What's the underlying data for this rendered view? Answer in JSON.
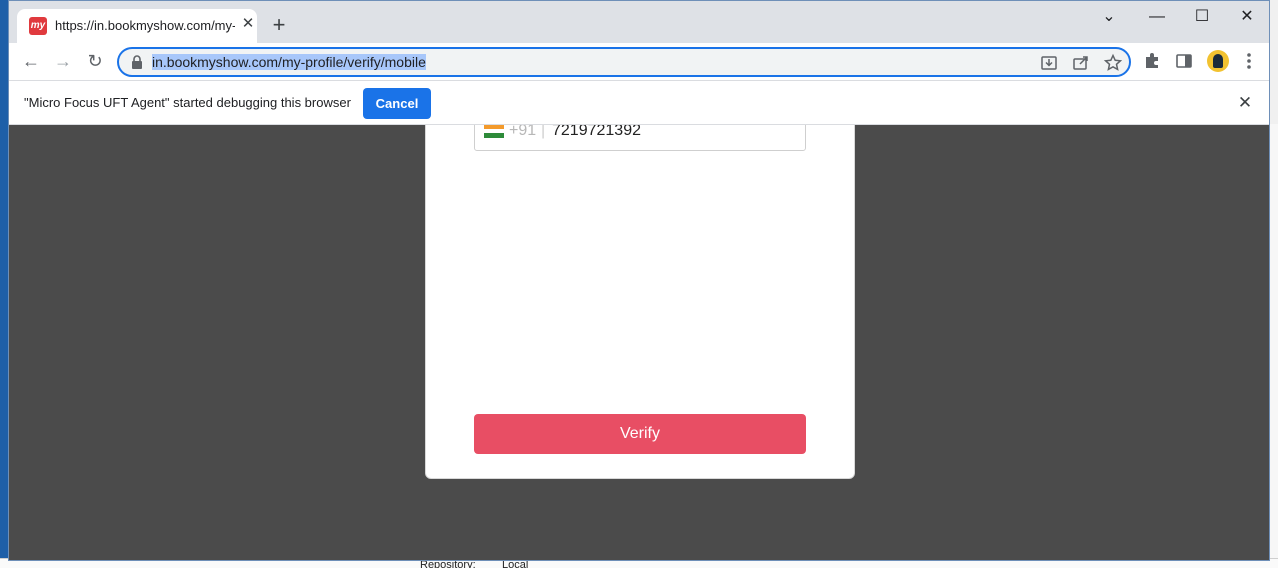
{
  "browser": {
    "tab": {
      "title": "https://in.bookmyshow.com/my-",
      "favicon_text": "my",
      "close_glyph": "✕"
    },
    "new_tab_glyph": "+",
    "window_controls": {
      "tab_search": "⌄",
      "minimize": "—",
      "maximize": "☐",
      "close": "✕"
    },
    "toolbar": {
      "back_glyph": "←",
      "forward_glyph": "→",
      "reload_glyph": "↻",
      "url": "in.bookmyshow.com/my-profile/verify/mobile"
    },
    "infobar": {
      "message": "\"Micro Focus UFT Agent\" started debugging this browser",
      "cancel_label": "Cancel",
      "close_glyph": "✕"
    }
  },
  "page": {
    "phone": {
      "country_code": "+91",
      "separator": "|",
      "number": "7219721392"
    },
    "verify_label": "Verify"
  },
  "background_app": {
    "repository_label": "Repository:",
    "repository_value": "Local"
  },
  "colors": {
    "accent_blue": "#1a73e8",
    "verify_red": "#e84e64",
    "overlay": "#4b4b4b"
  }
}
